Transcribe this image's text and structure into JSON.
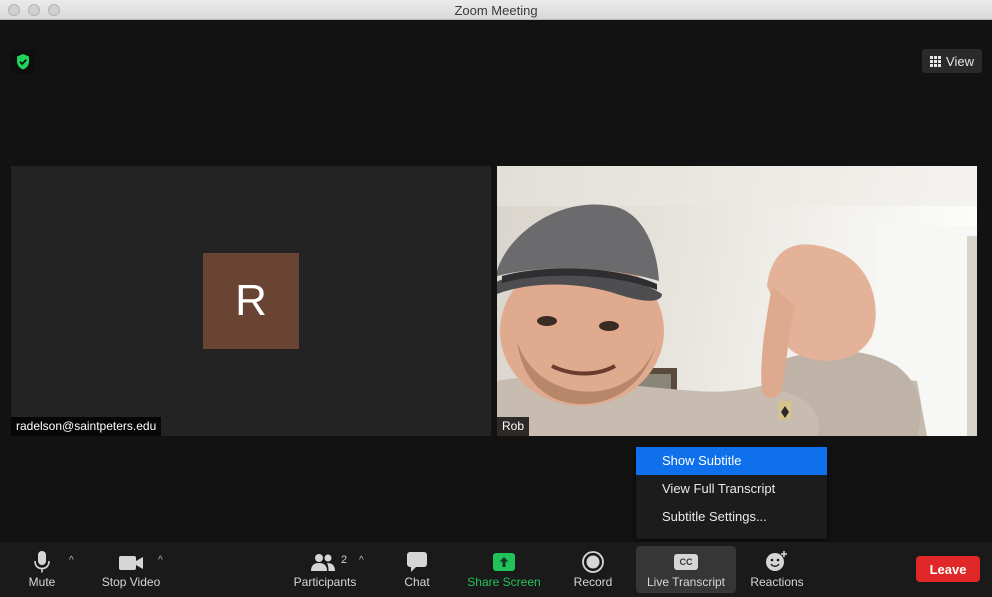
{
  "window": {
    "title": "Zoom Meeting"
  },
  "header": {
    "view_label": "View"
  },
  "participants": [
    {
      "name": "radelson@saintpeters.edu",
      "initial": "R",
      "avatar_color": "#6a4433"
    },
    {
      "name": "Rob"
    }
  ],
  "subtitle_menu": {
    "items": [
      {
        "label": "Show Subtitle",
        "selected": true
      },
      {
        "label": "View Full Transcript",
        "selected": false
      },
      {
        "label": "Subtitle Settings...",
        "selected": false
      }
    ]
  },
  "toolbar": {
    "mute_label": "Mute",
    "stop_video_label": "Stop Video",
    "participants_label": "Participants",
    "participants_count": "2",
    "chat_label": "Chat",
    "share_screen_label": "Share Screen",
    "record_label": "Record",
    "live_transcript_label": "Live Transcript",
    "cc_text": "CC",
    "reactions_label": "Reactions",
    "leave_label": "Leave"
  },
  "colors": {
    "accent": "#0e71eb",
    "share_green": "#21c25a",
    "leave_red": "#e02828",
    "shield_green": "#1fd35b"
  }
}
